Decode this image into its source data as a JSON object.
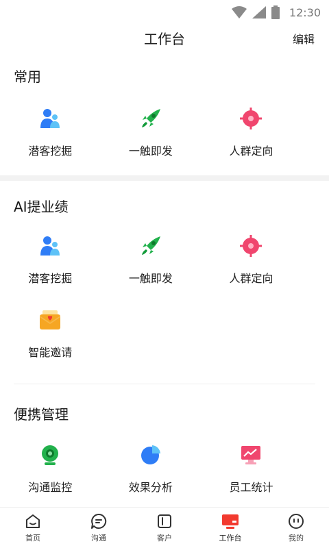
{
  "status_bar": {
    "time": "12:30"
  },
  "header": {
    "title": "工作台",
    "edit_label": "编辑"
  },
  "sections": [
    {
      "title": "常用",
      "items": [
        {
          "label": "潜客挖掘",
          "icon": "users-icon"
        },
        {
          "label": "一触即发",
          "icon": "rocket-icon"
        },
        {
          "label": "人群定向",
          "icon": "target-icon"
        }
      ]
    },
    {
      "title": "AI提业绩",
      "items": [
        {
          "label": "潜客挖掘",
          "icon": "users-icon"
        },
        {
          "label": "一触即发",
          "icon": "rocket-icon"
        },
        {
          "label": "人群定向",
          "icon": "target-icon"
        },
        {
          "label": "智能邀请",
          "icon": "invite-envelope-icon"
        }
      ]
    },
    {
      "title": "便携管理",
      "items": [
        {
          "label": "沟通监控",
          "icon": "camera-monitor-icon"
        },
        {
          "label": "效果分析",
          "icon": "pie-chart-icon"
        },
        {
          "label": "员工统计",
          "icon": "trend-board-icon"
        }
      ]
    }
  ],
  "tab_bar": {
    "tabs": [
      {
        "label": "首页",
        "icon": "home-icon"
      },
      {
        "label": "沟通",
        "icon": "chat-icon"
      },
      {
        "label": "客户",
        "icon": "customer-icon"
      },
      {
        "label": "工作台",
        "icon": "workbench-icon"
      },
      {
        "label": "我的",
        "icon": "profile-icon"
      }
    ],
    "active_index": 3
  },
  "colors": {
    "blue": "#2f7df6",
    "light_blue": "#5ec2f7",
    "green": "#22b14c",
    "pink": "#f0466e",
    "orange": "#f6a623",
    "red": "#f23a2f"
  }
}
